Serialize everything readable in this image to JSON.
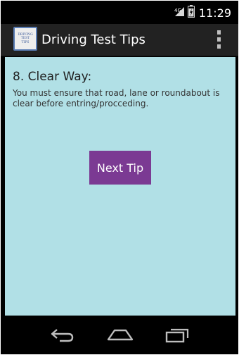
{
  "status_bar": {
    "time": "11:29",
    "icons": [
      "signal-icon",
      "battery-icon"
    ]
  },
  "action_bar": {
    "title": "Driving Test Tips",
    "icon_lines": [
      "DRIVING",
      "TEST",
      "TIPS"
    ],
    "menu_icon": "overflow-menu-icon"
  },
  "tip": {
    "title": "8. Clear Way:",
    "text": "You must ensure that road, lane or roundabout is clear before entring/procceding."
  },
  "next_button": {
    "label": "Next Tip"
  },
  "nav_bar": {
    "icons": [
      "back-icon",
      "home-icon",
      "recent-apps-icon"
    ]
  },
  "colors": {
    "content_bg": "#b1e0e6",
    "button_bg": "#7b3a93",
    "action_bar_bg": "#222222"
  }
}
